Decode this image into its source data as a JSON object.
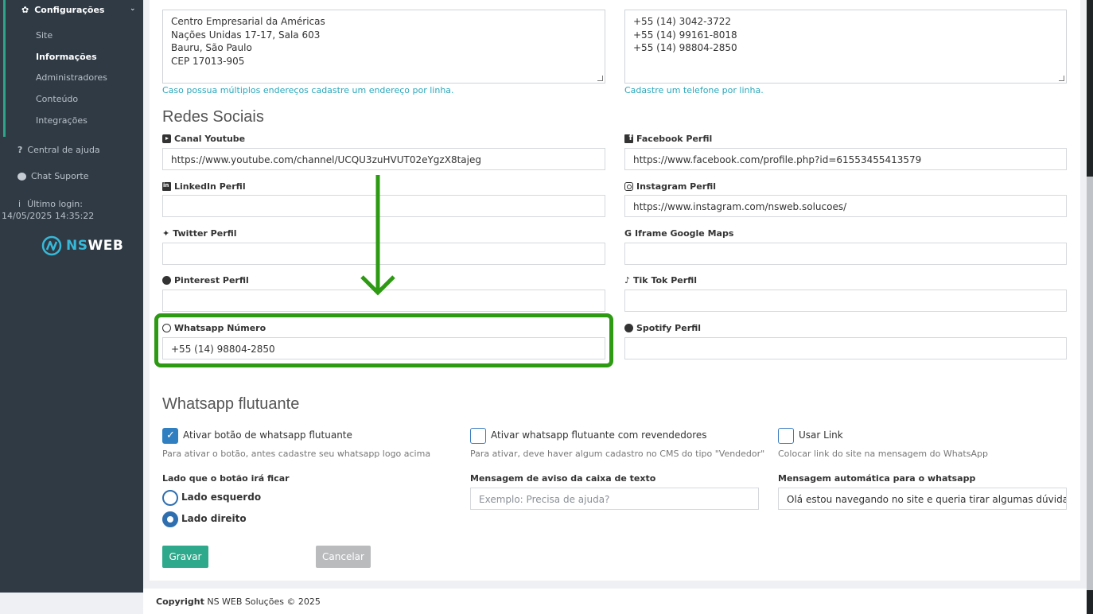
{
  "sidebar": {
    "config_label": "Configurações",
    "sub_items": [
      "Site",
      "Informações",
      "Administradores",
      "Conteúdo",
      "Integrações"
    ],
    "active_item": "Informações",
    "help_label": "Central de ajuda",
    "chat_label": "Chat Suporte",
    "last_login_label": "Último login:",
    "last_login_value": "14/05/2025 14:35:22",
    "logo_ns": "NS",
    "logo_web": "WEB"
  },
  "address": {
    "lines": [
      "Centro Empresarial da Américas",
      "Nações Unidas 17-17, Sala 603",
      "Bauru, São Paulo",
      "CEP 17013-905"
    ],
    "help": "Caso possua múltiplos endereços cadastre um endereço por linha."
  },
  "phones": {
    "lines": [
      "+55 (14) 3042-3722",
      "+55 (14) 99161-8018",
      "+55 (14) 98804-2850"
    ],
    "help": "Cadastre um telefone por linha."
  },
  "social": {
    "title": "Redes Sociais",
    "youtube_label": "Canal Youtube",
    "youtube_value": "https://www.youtube.com/channel/UCQU3zuHVUT02eYgzX8tajeg",
    "facebook_label": "Facebook Perfil",
    "facebook_value": "https://www.facebook.com/profile.php?id=61553455413579",
    "linkedin_label": "LinkedIn Perfil",
    "linkedin_value": "",
    "instagram_label": "Instagram Perfil",
    "instagram_value": "https://www.instagram.com/nsweb.solucoes/",
    "twitter_label": "Twitter Perfil",
    "twitter_value": "",
    "maps_label": "Iframe Google Maps",
    "maps_value": "",
    "pinterest_label": "Pinterest Perfil",
    "pinterest_value": "",
    "tiktok_label": "Tik Tok Perfil",
    "tiktok_value": "",
    "whatsapp_label": "Whatsapp Número",
    "whatsapp_value": "+55 (14) 98804-2850",
    "spotify_label": "Spotify Perfil",
    "spotify_value": ""
  },
  "whatsapp_float": {
    "title": "Whatsapp flutuante",
    "enable_label": "Ativar botão de whatsapp flutuante",
    "enable_checked": true,
    "enable_help": "Para ativar o botão, antes cadastre seu whatsapp logo acima",
    "resellers_label": "Ativar whatsapp flutuante com revendedores",
    "resellers_checked": false,
    "resellers_help": "Para ativar, deve haver algum cadastro no CMS do tipo \"Vendedor\"",
    "use_link_label": "Usar Link",
    "use_link_checked": false,
    "use_link_help": "Colocar link do site na mensagem do WhatsApp",
    "side_label": "Lado que o botão irá ficar",
    "side_left": "Lado esquerdo",
    "side_right": "Lado direito",
    "side_selected": "Lado direito",
    "notice_label": "Mensagem de aviso da caixa de texto",
    "notice_placeholder": "Exemplo: Precisa de ajuda?",
    "auto_msg_label": "Mensagem automática para o whatsapp",
    "auto_msg_value": "Olá estou navegando no site e queria tirar algumas dúvidas!!"
  },
  "buttons": {
    "save": "Gravar",
    "cancel": "Cancelar"
  },
  "footer": {
    "copyright_bold": "Copyright",
    "copyright_text": "NS WEB Soluções © 2025"
  },
  "colors": {
    "sidebar_bg": "#2f3a45",
    "accent_green": "#2fa98b",
    "highlight_green": "#2e9a14",
    "checkbox_blue": "#2f7fc1",
    "help_cyan": "#2aa8bd"
  }
}
